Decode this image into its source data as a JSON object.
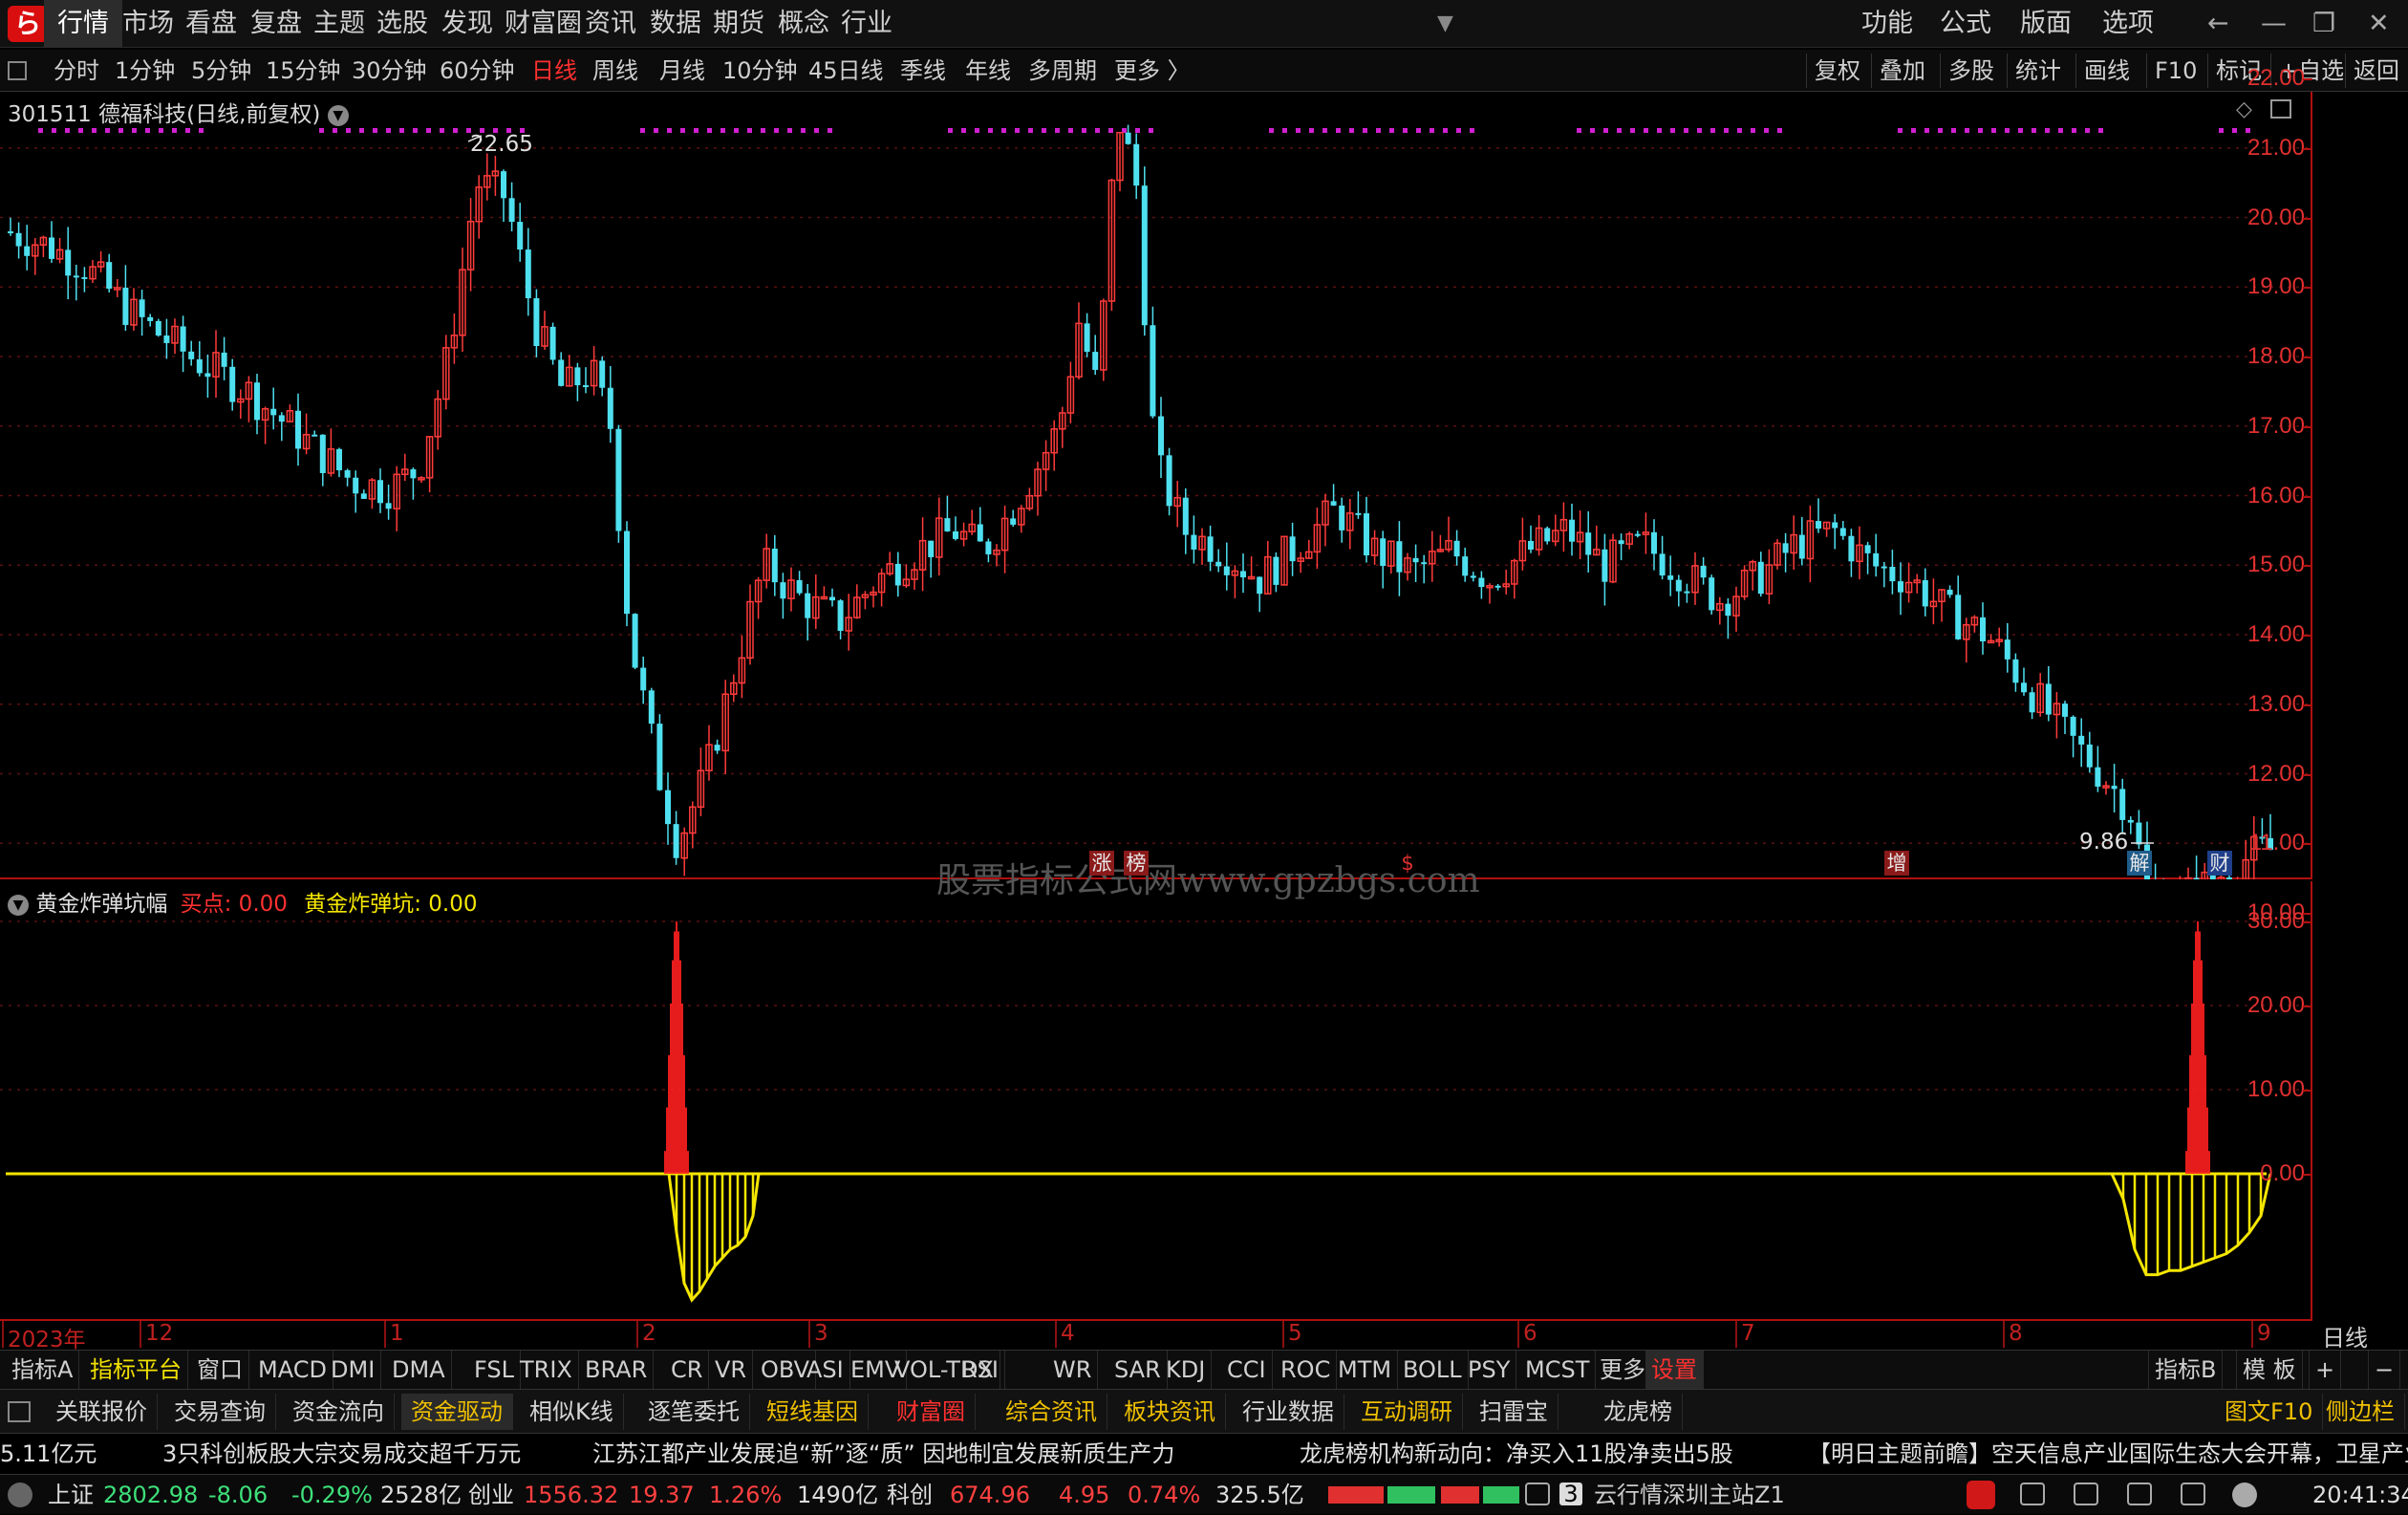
{
  "app": {
    "logo_glyph": "ら",
    "main_menu": [
      "行情",
      "市场",
      "看盘",
      "复盘",
      "主题",
      "选股",
      "发现",
      "财富圈",
      "资讯",
      "数据",
      "期货",
      "概念",
      "行业"
    ],
    "menu_more_glyph": "▼",
    "right_menu": [
      "功能",
      "公式",
      "版面",
      "选项"
    ],
    "window_controls": [
      "←",
      "—",
      "❐",
      "✕"
    ]
  },
  "period_bar": {
    "items": [
      "分时",
      "1分钟",
      "5分钟",
      "15分钟",
      "30分钟",
      "60分钟",
      "日线",
      "周线",
      "月线",
      "10分钟",
      "45日线",
      "季线",
      "年线",
      "多周期",
      "更多 〉"
    ],
    "active": "日线",
    "right_buttons": [
      "复权",
      "叠加",
      "多股",
      "统计",
      "画线",
      "F10",
      "标记",
      "+自选",
      "返回"
    ]
  },
  "chart_header": {
    "code": "301511",
    "name": "德福科技(日线,前复权)"
  },
  "main_chart": {
    "high_label": "22.65",
    "low_label": "9.86",
    "y_labels": [
      "22.00",
      "21.00",
      "20.00",
      "19.00",
      "18.00",
      "17.00",
      "16.00",
      "15.00",
      "14.00",
      "13.00",
      "12.00",
      "11.00",
      "10.00"
    ],
    "markers": [
      {
        "text": "涨",
        "color": "#e8e8e8",
        "bg": "#8b1a1a"
      },
      {
        "text": "榜",
        "color": "#e8e8e8",
        "bg": "#8b1a1a"
      },
      {
        "text": "$",
        "color": "#e03030",
        "bg": "transparent"
      },
      {
        "text": "增",
        "color": "#e8e8e8",
        "bg": "#8b1a1a"
      },
      {
        "text": "解",
        "color": "#e8e8e8",
        "bg": "#1f5c8a"
      },
      {
        "text": "财",
        "color": "#e8e8e8",
        "bg": "#1f3f8a"
      }
    ],
    "watermark": "股票指标公式网www.gpzbgs.com",
    "up_color": "#ff3b3b",
    "down_color": "#4fe0f0"
  },
  "indicator": {
    "name": "黄金炸弹坑幅",
    "buy_label": "买点: 0.00",
    "pit_label": "黄金炸弹坑: 0.00",
    "y_labels": [
      "30.00",
      "20.00",
      "10.00",
      "0.00"
    ],
    "line_color": "#f5e600",
    "spike_color": "#ff2020"
  },
  "x_axis": {
    "labels": [
      "2023年",
      "12",
      "1",
      "2",
      "3",
      "4",
      "5",
      "6",
      "7",
      "8",
      "9"
    ],
    "period": "日线"
  },
  "indicator_bar": {
    "items": [
      "指标A",
      "指标平台",
      "窗口",
      "MACD",
      "DMI",
      "DMA",
      "FSL",
      "TRIX",
      "BRAR",
      "CR",
      "VR",
      "OBV",
      "ASI",
      "EMV",
      "VOL-TDX",
      "RSI",
      "WR",
      "SAR",
      "KDJ",
      "CCI",
      "ROC",
      "MTM",
      "BOLL",
      "PSY",
      "MCST",
      "更多",
      "设置"
    ],
    "right": [
      "指标B",
      "模 板",
      "+",
      "−"
    ]
  },
  "toolbar": {
    "items": [
      "关联报价",
      "交易查询",
      "资金流向",
      "资金驱动",
      "相似K线",
      "逐笔委托",
      "短线基因",
      "财富圈",
      "综合资讯",
      "板块资讯",
      "行业数据",
      "互动调研",
      "扫雷宝",
      "龙虎榜"
    ],
    "right": [
      "图文F10",
      "侧边栏"
    ]
  },
  "ticker": [
    "5.11亿元",
    "3只科创板股大宗交易成交超千万元",
    "江苏江都产业发展追“新”逐“质” 因地制宜发展新质生产力",
    "龙虎榜机构新动向：净买入11股净卖出5股",
    "【明日主题前瞻】空天信息产业国际生态大会开幕，卫星产业"
  ],
  "status": {
    "sh_label": "上证",
    "sh_value": "2802.98",
    "sh_change": "-8.06",
    "sh_pct": "-0.29%",
    "sh_amount": "2528亿",
    "cy_label": "创业",
    "cy_value": "1556.32",
    "cy_change": "19.37",
    "cy_pct": "1.26%",
    "cy_amount": "1490亿",
    "kc_label": "科创",
    "kc_value": "674.96",
    "kc_change": "4.95",
    "kc_pct": "0.74%",
    "kc_amount": "325.5亿",
    "server_num": "3",
    "server": "云行情深圳主站Z1",
    "time": "20:41:34"
  }
}
